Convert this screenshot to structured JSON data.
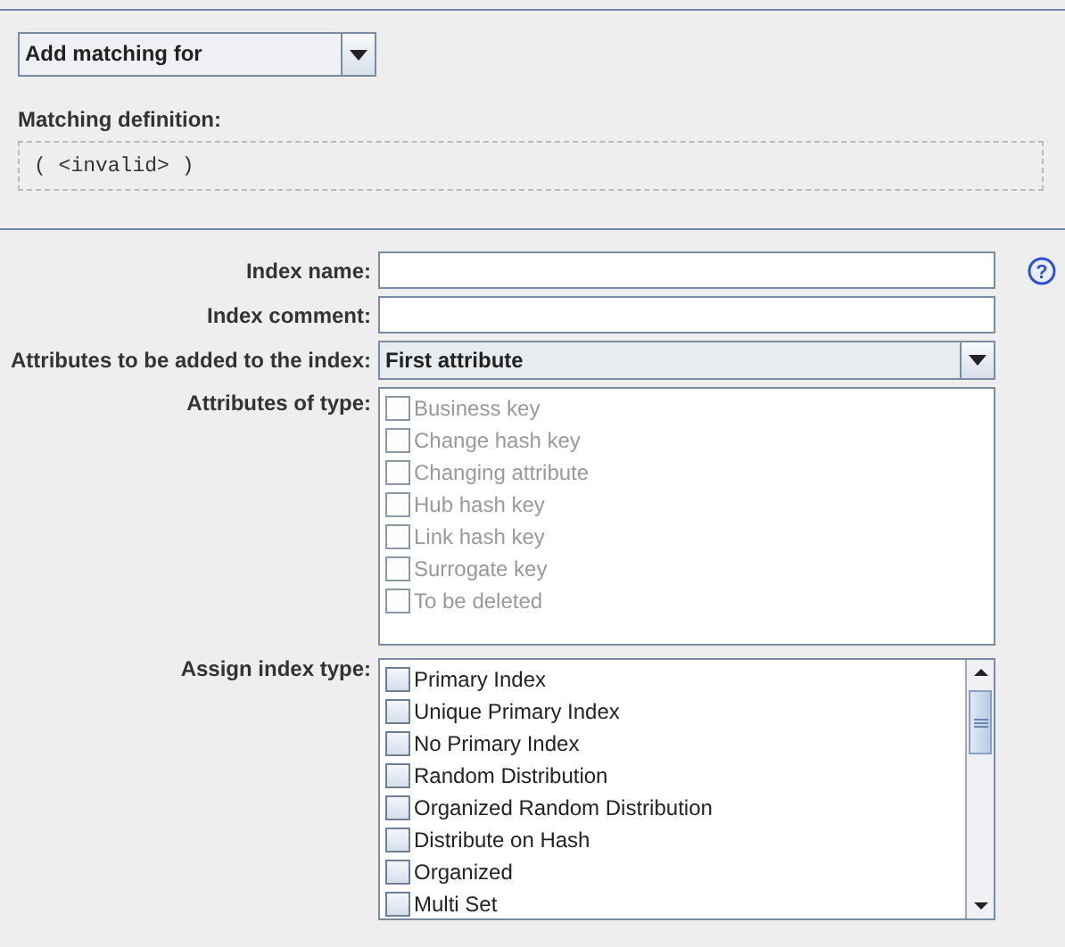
{
  "matching": {
    "dropdown": "Add matching for",
    "label": "Matching definition:",
    "definition": "( <invalid> )"
  },
  "form": {
    "index_name": {
      "label": "Index name:",
      "help": "?"
    },
    "index_comment": {
      "label": "Index comment:"
    },
    "attributes_to_add": {
      "label": "Attributes to be added to the index:",
      "value": "First attribute"
    },
    "attributes_of_type": {
      "label": "Attributes of type:",
      "items": [
        {
          "label": "Business key",
          "checked": false,
          "disabled": true
        },
        {
          "label": "Change hash key",
          "checked": false,
          "disabled": true
        },
        {
          "label": "Changing attribute",
          "checked": false,
          "disabled": true
        },
        {
          "label": "Hub hash key",
          "checked": false,
          "disabled": true
        },
        {
          "label": "Link hash key",
          "checked": false,
          "disabled": true
        },
        {
          "label": "Surrogate key",
          "checked": false,
          "disabled": true
        },
        {
          "label": "To be deleted",
          "checked": false,
          "disabled": true
        }
      ]
    },
    "assign_index_type": {
      "label": "Assign index type:",
      "items": [
        {
          "label": "Primary Index",
          "checked": false,
          "disabled": false
        },
        {
          "label": "Unique Primary Index",
          "checked": false,
          "disabled": false
        },
        {
          "label": "No Primary Index",
          "checked": false,
          "disabled": false
        },
        {
          "label": "Random Distribution",
          "checked": false,
          "disabled": false
        },
        {
          "label": "Organized Random Distribution",
          "checked": false,
          "disabled": false
        },
        {
          "label": "Distribute on Hash",
          "checked": false,
          "disabled": false
        },
        {
          "label": "Organized",
          "checked": false,
          "disabled": false
        },
        {
          "label": "Multi Set",
          "checked": false,
          "disabled": false
        }
      ]
    }
  }
}
